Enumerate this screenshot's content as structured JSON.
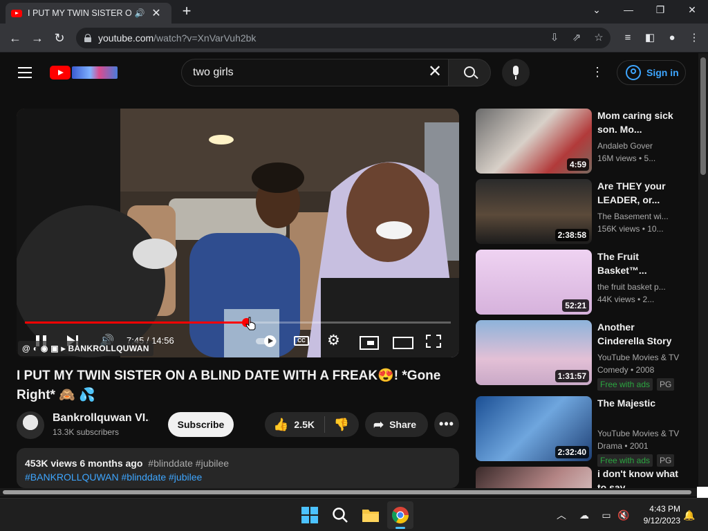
{
  "browser": {
    "tab_title": "I PUT MY TWIN SISTER ON A BLIND DATE WITH A FREAK",
    "new_tab_label": "+",
    "url_host": "youtube.com",
    "url_path": "/watch?v=XnVarVuh2bk"
  },
  "yt_header": {
    "search_query": "two girls",
    "sign_in_label": "Sign in"
  },
  "player": {
    "time_current": "7:45",
    "time_total": "14:56",
    "time_display": "7:45 / 14:56",
    "progress_fraction": 0.52,
    "watermark_text": "@ ◐ ◉ ▣ ▸ BANKROLLQUWAN",
    "cc_label": "CC"
  },
  "video": {
    "title": "I PUT MY TWIN SISTER ON A BLIND DATE WITH A FREAK😍! *Gone Right* 🙈 💦",
    "channel_name": "Bankrollquwan VI...",
    "subscribers": "13.3K subscribers",
    "subscribe_label": "Subscribe",
    "likes": "2.5K",
    "share_label": "Share",
    "more_label": "•••",
    "views_date": "453K views  6 months ago",
    "desc_tags": "#blinddate #jubilee",
    "desc_hashtags": "#BANKROLLQUWAN #blinddate #jubilee"
  },
  "recommendations": [
    {
      "title": "Mom caring sick son. Mo...",
      "channel": "Andaleb Gover",
      "meta": "16M views • 5...",
      "duration": "4:59",
      "thumb_color": "#5a5a5a",
      "badges": []
    },
    {
      "title": "Are THEY your LEADER, or...",
      "channel": "The Basement wi...",
      "meta": "156K views • 10...",
      "duration": "2:38:58",
      "thumb_color": "#3b3b3b",
      "badges": []
    },
    {
      "title": "The Fruit Basket™...",
      "channel": "the fruit basket p...",
      "meta": "44K views • 2...",
      "duration": "52:21",
      "thumb_color": "#e7c6ee",
      "badges": []
    },
    {
      "title": "Another Cinderella Story",
      "channel": "YouTube Movies & TV",
      "meta": "Comedy • 2008",
      "duration": "1:31:57",
      "thumb_color": "#c9a9c7",
      "badges": [
        "Free with ads",
        "PG"
      ]
    },
    {
      "title": "The Majestic",
      "channel": "YouTube Movies & TV",
      "meta": "Drama • 2001",
      "duration": "2:32:40",
      "thumb_color": "#2e6fb8",
      "badges": [
        "Free with ads",
        "PG"
      ]
    },
    {
      "title": "i don't know what to say",
      "channel": "",
      "meta": "",
      "duration": "",
      "thumb_color": "#6d4b4b",
      "badges": []
    }
  ],
  "taskbar": {
    "time": "4:43 PM",
    "date": "9/12/2023"
  },
  "colors": {
    "accent_red": "#ff0000",
    "link_blue": "#3ea6ff",
    "background": "#0f0f0f"
  }
}
